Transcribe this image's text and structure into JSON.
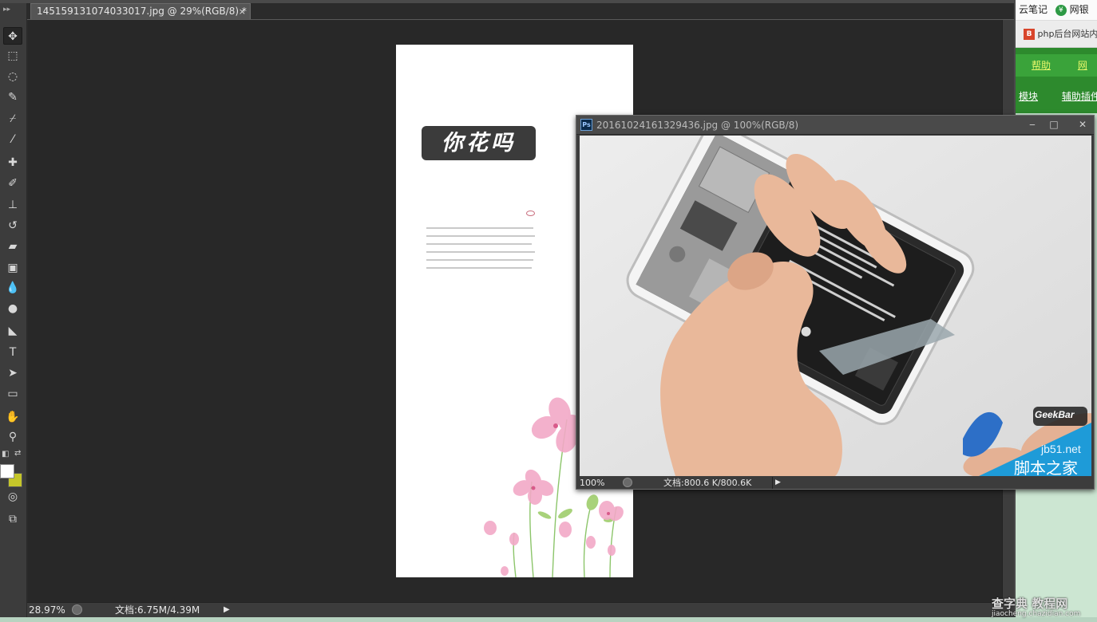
{
  "document": {
    "tab_title": "145159131074033017.jpg @ 29%(RGB/8) *",
    "tab_close": "×",
    "page_title": "你花吗",
    "status_zoom": "28.97%",
    "status_info": "文档:6.75M/4.39M"
  },
  "floating_window": {
    "app_icon": "Ps",
    "title": "20161024161329436.jpg @ 100%(RGB/8)",
    "status_zoom": "100%",
    "status_info": "文档:800.6 K/800.6K",
    "buttons": {
      "minimize": "‒",
      "maximize": "□",
      "close": "✕"
    },
    "image_overlay": {
      "brand": "GeekBar",
      "site": "jb51.net",
      "site_name": "脚本之家"
    }
  },
  "browser": {
    "top_items": [
      "云笔记",
      "网银"
    ],
    "tab_label": "php后台网站内",
    "nav_row1": [
      "帮助",
      "网"
    ],
    "nav_row2": [
      "模块",
      "辅助插件"
    ]
  },
  "watermark": {
    "main": "查字典 教程网",
    "sub": "jiaocheng.chazidian.com"
  },
  "colors": {
    "background_color": "#ffffff",
    "foreground_color": "#c5c62a"
  },
  "tools": [
    "move-tool-icon",
    "marquee-tool-icon",
    "lasso-tool-icon",
    "quick-select-tool-icon",
    "crop-tool-icon",
    "eyedropper-tool-icon",
    "healing-brush-icon",
    "brush-tool-icon",
    "clone-stamp-icon",
    "history-brush-icon",
    "eraser-tool-icon",
    "gradient-tool-icon",
    "blur-tool-icon",
    "dodge-tool-icon",
    "pen-tool-icon",
    "type-tool-icon",
    "path-select-tool-icon",
    "shape-tool-icon",
    "hand-tool-icon",
    "zoom-tool-icon",
    "quick-mask-icon",
    "screen-mode-icon"
  ]
}
